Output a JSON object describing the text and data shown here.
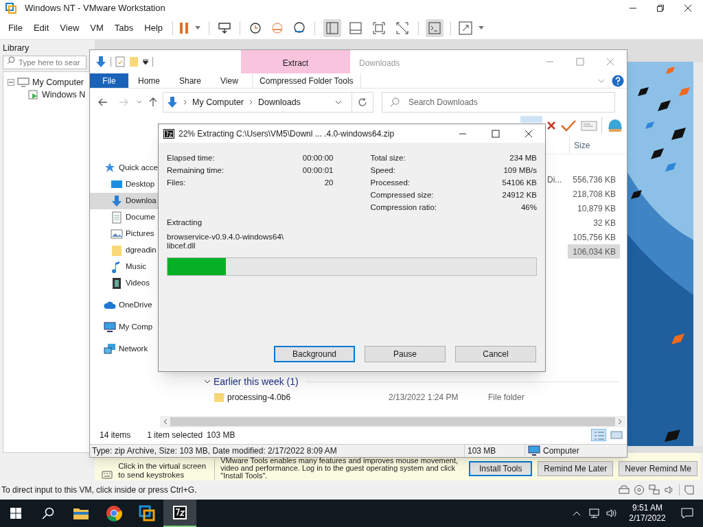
{
  "window": {
    "title": "Windows NT - VMware Workstation"
  },
  "menu": [
    "File",
    "Edit",
    "View",
    "VM",
    "Tabs",
    "Help"
  ],
  "library": {
    "title": "Library",
    "search_placeholder": "Type here to sear",
    "tree": [
      {
        "label": "My Computer",
        "expanded": true,
        "children": [
          {
            "label": "Windows N"
          }
        ]
      }
    ]
  },
  "explorer": {
    "title": "Downloads",
    "context_tab": "Extract",
    "ribbon_tabs": [
      {
        "label": "File",
        "kind": "file"
      },
      {
        "label": "Home",
        "kind": "tab"
      },
      {
        "label": "Share",
        "kind": "tab"
      },
      {
        "label": "View",
        "kind": "tab"
      },
      {
        "label": "Compressed Folder Tools",
        "kind": "contextual"
      }
    ],
    "address": [
      "My Computer",
      "Downloads"
    ],
    "search_placeholder": "Search Downloads",
    "nav": [
      {
        "label": "Quick acce",
        "kind": "star",
        "selected": false
      },
      {
        "label": "Desktop",
        "kind": "desktop",
        "selected": false
      },
      {
        "label": "Downloa",
        "kind": "download",
        "selected": true
      },
      {
        "label": "Docume",
        "kind": "document",
        "selected": false
      },
      {
        "label": "Pictures",
        "kind": "pictures",
        "selected": false
      },
      {
        "label": "dgreadin",
        "kind": "folder",
        "selected": false
      },
      {
        "label": "Music",
        "kind": "music",
        "selected": false
      },
      {
        "label": "Videos",
        "kind": "videos",
        "selected": false
      },
      {
        "label": "OneDrive",
        "kind": "cloud",
        "selected": false
      },
      {
        "label": "My Comp",
        "kind": "computer",
        "selected": false
      },
      {
        "label": "Network",
        "kind": "network",
        "selected": false
      }
    ],
    "columns": [
      "Size"
    ],
    "rows": [
      {
        "type": "Di...",
        "size": "556,736 KB",
        "selected": false
      },
      {
        "size": "218,708 KB",
        "selected": false
      },
      {
        "size": "10,879 KB",
        "selected": false
      },
      {
        "size": "32 KB",
        "selected": false
      },
      {
        "size": "105,756 KB",
        "selected": false
      },
      {
        "size": "106,034 KB",
        "selected": true
      }
    ],
    "group": {
      "label": "Earlier this week (1)",
      "expanded": true,
      "items": [
        {
          "name": "processing-4.0b6",
          "date": "2/13/2022 1:24 PM",
          "type": "File folder"
        }
      ]
    },
    "status": {
      "count": "14 items",
      "selection": "1 item selected",
      "selection_size": "103 MB"
    },
    "details_bar": {
      "info": "Type: zip Archive, Size: 103 MB, Date modified: 2/17/2022 8:09 AM",
      "size": "103 MB",
      "location": "Computer"
    }
  },
  "dialog": {
    "title": "22% Extracting C:\\Users\\VM5\\Downl ... .4.0-windows64.zip",
    "left_stats": [
      {
        "label": "Elapsed time:",
        "value": "00:00:00"
      },
      {
        "label": "Remaining time:",
        "value": "00:00:01"
      },
      {
        "label": "Files:",
        "value": "20"
      }
    ],
    "right_stats": [
      {
        "label": "Total size:",
        "value": "234 MB"
      },
      {
        "label": "Speed:",
        "value": "109 MB/s"
      },
      {
        "label": "Processed:",
        "value": "54106 KB"
      },
      {
        "label": "Compressed size:",
        "value": "24912 KB"
      },
      {
        "label": "Compression ratio:",
        "value": "46%"
      }
    ],
    "action": "Extracting",
    "file_path": "browservice-v0.9.4.0-windows64\\",
    "file_name": "libcef.dll",
    "progress": {
      "level": 0.158
    },
    "buttons": [
      {
        "label": "Background",
        "default": true
      },
      {
        "label": "Pause",
        "default": false
      },
      {
        "label": "Cancel",
        "default": false
      }
    ]
  },
  "tools_bar": {
    "hint": "Click in the virtual screen to send keystrokes",
    "message": "VMware Tools enables many features and improves mouse movement, video and performance. Log in to the guest operating system and click \"Install Tools\".",
    "buttons": [
      {
        "label": "Install Tools",
        "default": true
      },
      {
        "label": "Remind Me Later",
        "default": false
      },
      {
        "label": "Never Remind Me",
        "default": false
      }
    ]
  },
  "status_bar": "To direct input to this VM, click inside or press Ctrl+G.",
  "taskbar": {
    "time": "9:51 AM",
    "date": "2/17/2022"
  }
}
